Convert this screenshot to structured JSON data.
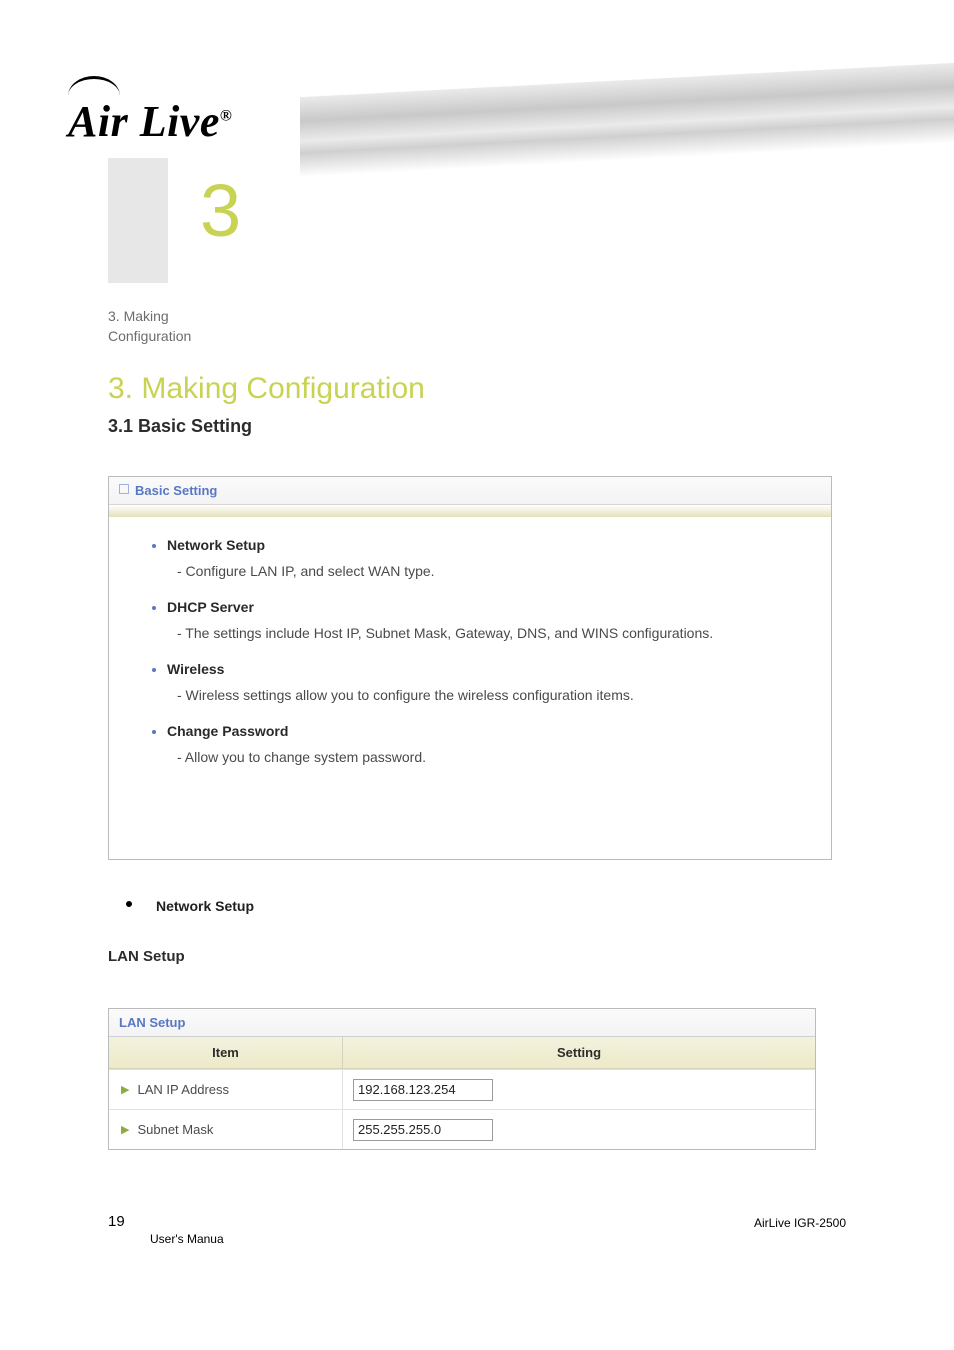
{
  "logo": {
    "text": "Air Live",
    "registered": "®"
  },
  "chapter": {
    "number_big": "3",
    "caption1": "3. Making",
    "caption2": "Configuration",
    "title": "3. Making Configuration",
    "section": "3.1 Basic Setting"
  },
  "basic_panel": {
    "title": "Basic Setting",
    "items": [
      {
        "name": "Network Setup",
        "desc": "- Configure LAN IP, and select WAN type."
      },
      {
        "name": "DHCP Server",
        "desc": "- The settings include Host IP, Subnet Mask, Gateway, DNS, and WINS configurations."
      },
      {
        "name": "Wireless",
        "desc": "- Wireless settings allow you to configure the wireless configuration items."
      },
      {
        "name": "Change Password",
        "desc": "- Allow you to change system password."
      }
    ]
  },
  "after_bullet": {
    "heading": "Network Setup"
  },
  "lan": {
    "sub_h3": "LAN Setup",
    "panel_title": "LAN Setup",
    "col_item": "Item",
    "col_setting": "Setting",
    "row1_label": "LAN IP Address",
    "row1_value": "192.168.123.254",
    "row2_label": "Subnet Mask",
    "row2_value": "255.255.255.0"
  },
  "footer": {
    "page_no": "19",
    "model": "AirLive IGR-2500",
    "manual": "User's Manua"
  }
}
